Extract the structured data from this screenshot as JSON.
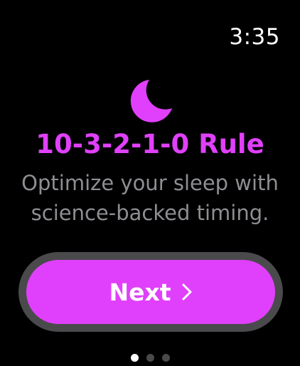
{
  "status_bar": {
    "time": "3:35"
  },
  "onboarding": {
    "icon": "moon-icon",
    "title": "10-3-2-1-0 Rule",
    "subtitle_line1": "Optimize your sleep with",
    "subtitle_line2": "science-backed timing.",
    "next_label": "Next",
    "next_icon": "chevron-right-icon"
  },
  "pagination": {
    "current_page": 1,
    "total_pages": 3
  },
  "colors": {
    "accent": "#e040fb",
    "background": "#000000",
    "subtitle": "#8e8e93",
    "button_ring": "#4a4a4c",
    "dot_inactive": "#4a4a4c",
    "dot_active": "#ffffff"
  }
}
